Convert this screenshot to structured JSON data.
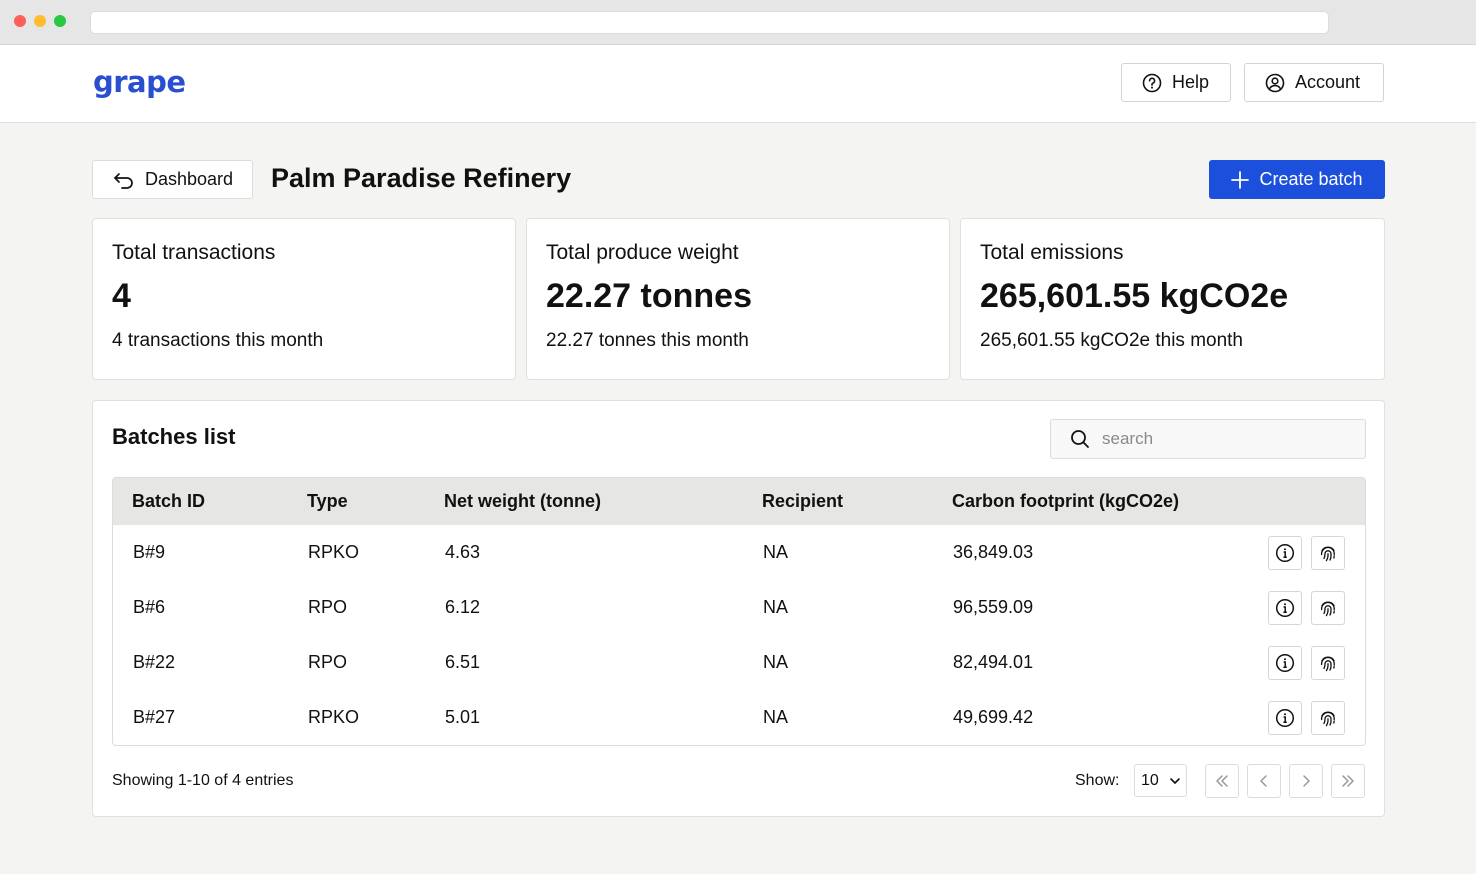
{
  "header": {
    "logo": "grape",
    "help_label": "Help",
    "account_label": "Account"
  },
  "title_row": {
    "back_label": "Dashboard",
    "page_title": "Palm Paradise Refinery",
    "create_label": "Create batch"
  },
  "stats": [
    {
      "label": "Total transactions",
      "value": "4",
      "sub": "4 transactions this month"
    },
    {
      "label": "Total produce weight",
      "value": "22.27 tonnes",
      "sub": "22.27 tonnes this month"
    },
    {
      "label": "Total emissions",
      "value": "265,601.55 kgCO2e",
      "sub": "265,601.55 kgCO2e this month"
    }
  ],
  "batches": {
    "title": "Batches list",
    "search_placeholder": "search",
    "columns": [
      "Batch ID",
      "Type",
      "Net weight (tonne)",
      "Recipient",
      "Carbon footprint (kgCO2e)"
    ],
    "rows": [
      {
        "id": "B#9",
        "type": "RPKO",
        "weight": "4.63",
        "recipient": "NA",
        "carbon": "36,849.03"
      },
      {
        "id": "B#6",
        "type": "RPO",
        "weight": "6.12",
        "recipient": "NA",
        "carbon": "96,559.09"
      },
      {
        "id": "B#22",
        "type": "RPO",
        "weight": "6.51",
        "recipient": "NA",
        "carbon": "82,494.01"
      },
      {
        "id": "B#27",
        "type": "RPKO",
        "weight": "5.01",
        "recipient": "NA",
        "carbon": "49,699.42"
      }
    ],
    "row_icons": [
      "info-icon",
      "fingerprint-icon"
    ],
    "footer_text": "Showing 1-10 of 4 entries",
    "show_label": "Show:",
    "page_size": "10"
  },
  "colors": {
    "brand": "#2a4ed0",
    "primary_button": "#1b4fdc",
    "table_header_bg": "#e6e6e4",
    "page_bg": "#f4f4f2"
  }
}
